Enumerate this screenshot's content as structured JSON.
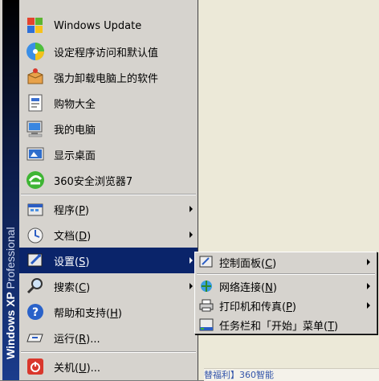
{
  "banner": {
    "brand": "Windows XP",
    "edition": "Professional"
  },
  "pinned": [
    {
      "name": "windows-update",
      "label": "Windows Update",
      "icon": "windows-update-icon"
    },
    {
      "name": "set-program-defaults",
      "label": "设定程序访问和默认值",
      "icon": "default-programs-icon"
    },
    {
      "name": "uninstall-software",
      "label": "强力卸载电脑上的软件",
      "icon": "uninstall-box-icon"
    },
    {
      "name": "shopping",
      "label": "购物大全",
      "icon": "shopping-doc-icon"
    },
    {
      "name": "my-computer",
      "label": "我的电脑",
      "icon": "computer-icon"
    },
    {
      "name": "show-desktop",
      "label": "显示桌面",
      "icon": "desktop-icon"
    },
    {
      "name": "browser-360",
      "label": "360安全浏览器7",
      "icon": "browser-360-icon"
    }
  ],
  "menu": [
    {
      "name": "programs",
      "text": "程序(",
      "key": "P",
      "end": ")",
      "icon": "programs-icon",
      "submenu": true
    },
    {
      "name": "documents",
      "text": "文档(",
      "key": "D",
      "end": ")",
      "icon": "documents-icon",
      "submenu": true
    },
    {
      "name": "settings",
      "text": "设置(",
      "key": "S",
      "end": ")",
      "icon": "settings-icon",
      "submenu": true,
      "selected": true
    },
    {
      "name": "search",
      "text": "搜索(",
      "key": "C",
      "end": ")",
      "icon": "search-icon",
      "submenu": true
    },
    {
      "name": "help",
      "text": "帮助和支持(",
      "key": "H",
      "end": ")",
      "icon": "help-icon",
      "submenu": false
    },
    {
      "name": "run",
      "text": "运行(",
      "key": "R",
      "end": ")...",
      "icon": "run-icon",
      "submenu": false
    }
  ],
  "shutdown": {
    "text": "关机(",
    "key": "U",
    "end": ")..."
  },
  "settings_submenu": [
    {
      "name": "control-panel",
      "text": "控制面板(",
      "key": "C",
      "end": ")",
      "icon": "control-panel-icon",
      "submenu": true
    },
    {
      "name": "network-connections",
      "text": "网络连接(",
      "key": "N",
      "end": ")",
      "icon": "network-icon",
      "submenu": true
    },
    {
      "name": "printers-faxes",
      "text": "打印机和传真(",
      "key": "P",
      "end": ")",
      "icon": "printer-icon",
      "submenu": true
    },
    {
      "name": "taskbar-start-menu",
      "text": "任务栏和「开始」菜单(",
      "key": "T",
      "end": ")",
      "icon": "taskbar-icon",
      "submenu": false
    }
  ],
  "taskbar_snippet": "替福利】360智能",
  "colors": {
    "selection": "#0a246a",
    "menu_bg": "#d6d3ce",
    "banner_dark": "#000000",
    "banner_light": "#1a3c8c"
  }
}
